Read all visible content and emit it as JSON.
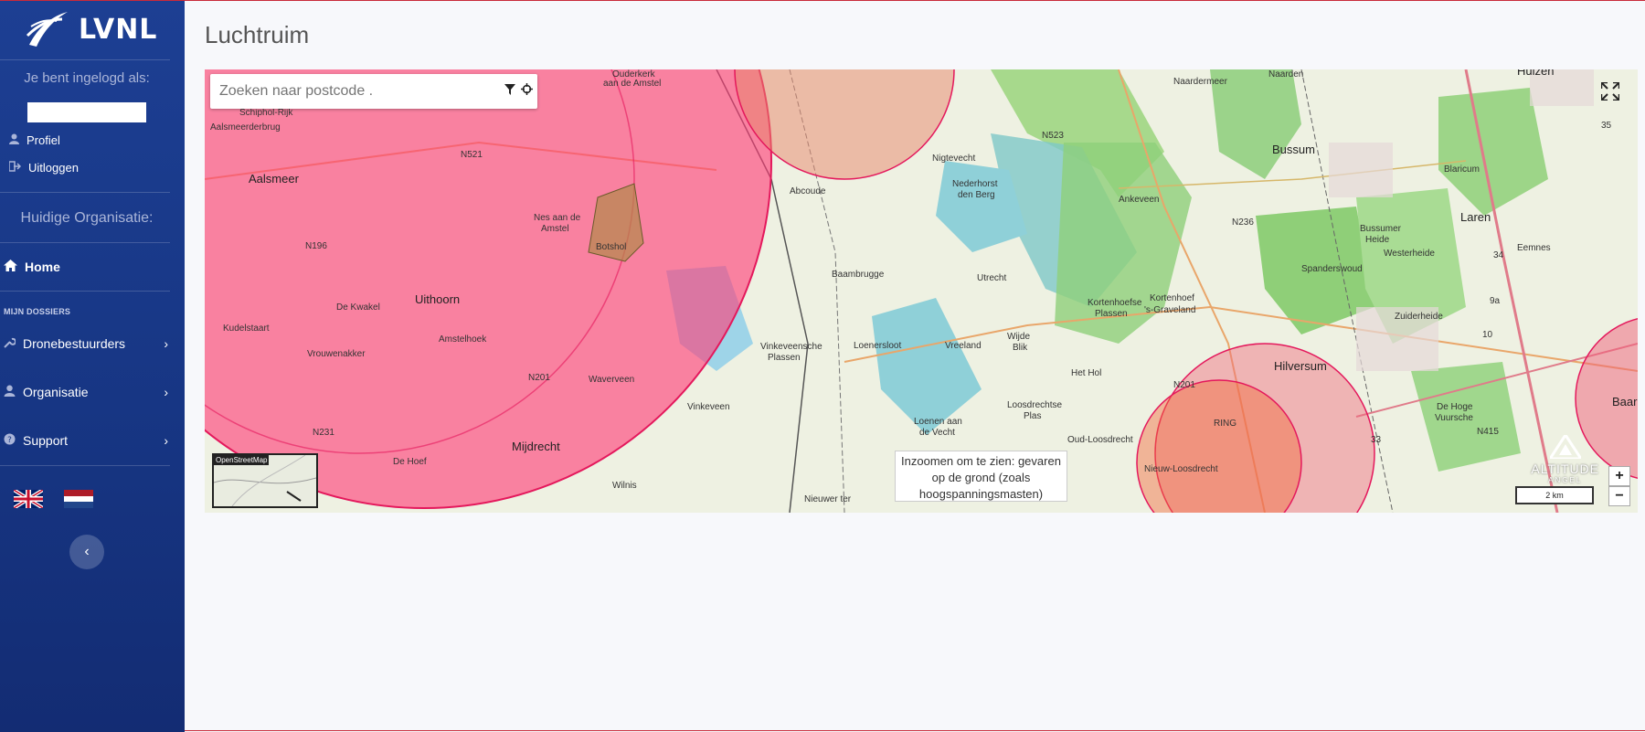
{
  "sidebar": {
    "logo_text": "LVNL",
    "logged_in_label": "Je bent ingelogd als:",
    "profile_label": "Profiel",
    "logout_label": "Uitloggen",
    "org_label": "Huidige Organisatie:",
    "home_label": "Home",
    "section_label": "MIJN DOSSIERS",
    "items": [
      {
        "label": "Dronebestuurders"
      },
      {
        "label": "Organisatie"
      },
      {
        "label": "Support"
      }
    ]
  },
  "page": {
    "title": "Luchtruim"
  },
  "map": {
    "search_placeholder": "Zoeken naar postcode .",
    "tooltip_line1": "Inzoomen om te zien: gevaren",
    "tooltip_line2": "op de grond (zoals",
    "tooltip_line3": "hoogspanningsmasten)",
    "minimap_label": "OpenStreetMap",
    "scale_label": "2 km",
    "brand_label": "ALTITUDE",
    "brand_sub": "ANGEL",
    "zoom_in": "+",
    "zoom_out": "−",
    "labels": [
      "Schiphol-Rijk",
      "Aalsmeerderbrug",
      "Aalsmeer",
      "N521",
      "N196",
      "Uithoorn",
      "De Kwakel",
      "Kudelstaart",
      "Vrouwenakker",
      "Amstelhoek",
      "Nes aan de",
      "Amstel",
      "Botshol",
      "Waverveen",
      "N201",
      "N231",
      "De Hoef",
      "Mijdrecht",
      "Wilnis",
      "Vinkeveen",
      "Vinkeveensche",
      "Plassen",
      "Baambrugge",
      "Loenersloot",
      "Vreeland",
      "Loenen aan",
      "de Vecht",
      "Nieuwer ter",
      "Abcoude",
      "Nigtevecht",
      "Nederhorst",
      "den Berg",
      "N523",
      "Ankeveen",
      "Kortenhoef",
      "'s-Graveland",
      "Oud-Loosdrecht",
      "Nieuw-Loosdrecht",
      "RING",
      "Hilversum",
      "Bussum",
      "Naarden",
      "Huizen",
      "Blaricum",
      "Laren",
      "Eemnes",
      "N236",
      "Naardermeer",
      "Spanderswoud",
      "Bussumer",
      "Heide",
      "Westerheide",
      "Zuiderheide",
      "De Hoge",
      "Vuursche",
      "N415",
      "Baarn",
      "Het Hol",
      "Wijde",
      "Blik",
      "Loosdrechtse",
      "Plas",
      "Kortenhoefse",
      "Plassen",
      "Utrecht",
      "Ouderkerk",
      "aan de Amstel",
      "10",
      "33",
      "34",
      "35",
      "9a",
      "N201"
    ]
  },
  "colors": {
    "sidebar": "#1b3a8c",
    "restricted_zone": "#ff3c78",
    "water": "#9ed4e8",
    "nature": "#8fd07a"
  }
}
